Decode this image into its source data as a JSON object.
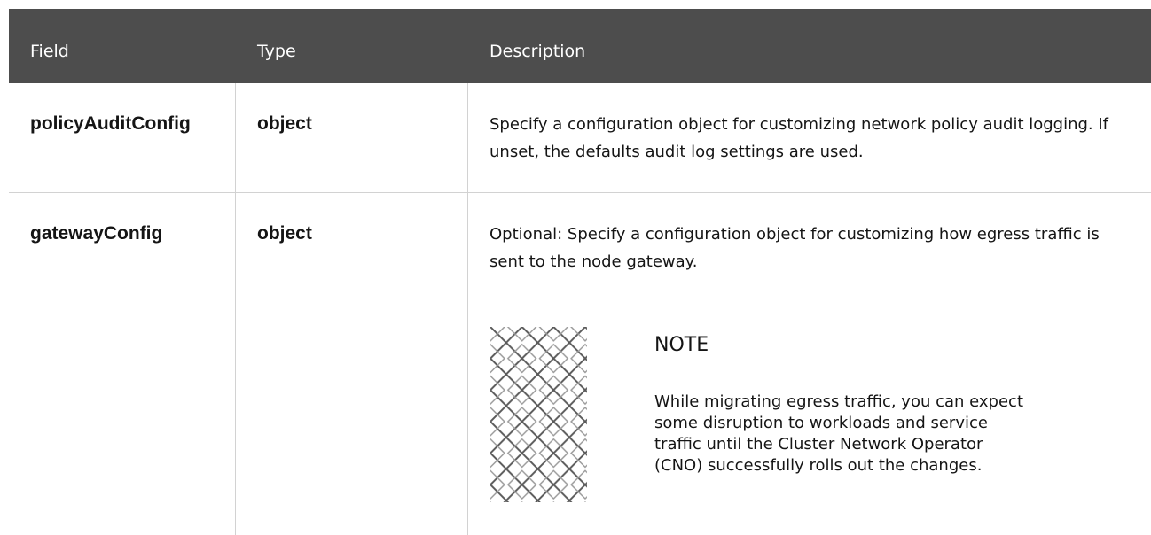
{
  "table": {
    "headers": [
      "Field",
      "Type",
      "Description"
    ],
    "rows": [
      {
        "field": "policyAuditConfig",
        "type": "object",
        "description": "Specify a configuration object for customizing network policy audit logging. If unset, the defaults audit log settings are used."
      },
      {
        "field": "gatewayConfig",
        "type": "object",
        "description": "Optional: Specify a configuration object for customizing how egress traffic is sent to the node gateway.",
        "note": {
          "icon": "note-pattern-icon",
          "title": "NOTE",
          "text": "While migrating egress traffic, you can expect some disruption to workloads and service traffic until the Cluster Network Operator (CNO) successfully rolls out the changes."
        }
      }
    ]
  },
  "colors": {
    "header_bg": "#4d4d4d",
    "header_text": "#ffffff",
    "border": "#d2d2d2",
    "text": "#151515"
  }
}
